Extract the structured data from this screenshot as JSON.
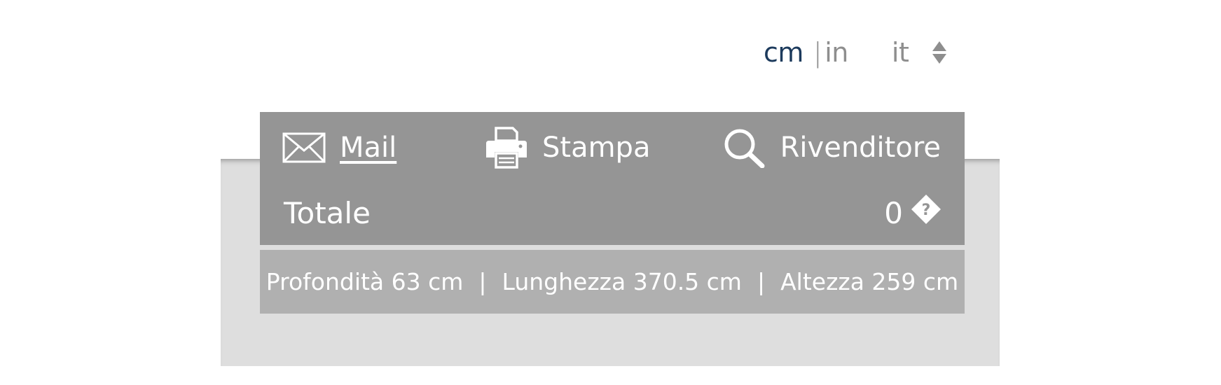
{
  "units": {
    "cm_label": "cm",
    "separator": "|",
    "in_label": "in",
    "active": "cm",
    "active_color": "#1c3a5c",
    "inactive_color": "#8e8e8e"
  },
  "language": {
    "selected": "it",
    "icon": "sort-arrows-icon"
  },
  "actions": {
    "mail_label": "Mail",
    "mail_icon": "envelope-icon",
    "print_label": "Stampa",
    "print_icon": "printer-icon",
    "dealer_label": "Rivenditore",
    "dealer_icon": "search-icon"
  },
  "total": {
    "label": "Totale",
    "value": "0",
    "icon": "help-diamond-icon"
  },
  "dimensions": {
    "depth": "Profondità 63 cm",
    "length": "Lunghezza 370.5 cm",
    "height": "Altezza 259 cm",
    "separator": "|"
  },
  "colors": {
    "panel": "#959595",
    "dims_bar": "#b0b0b0",
    "backdrop": "#dedede"
  }
}
